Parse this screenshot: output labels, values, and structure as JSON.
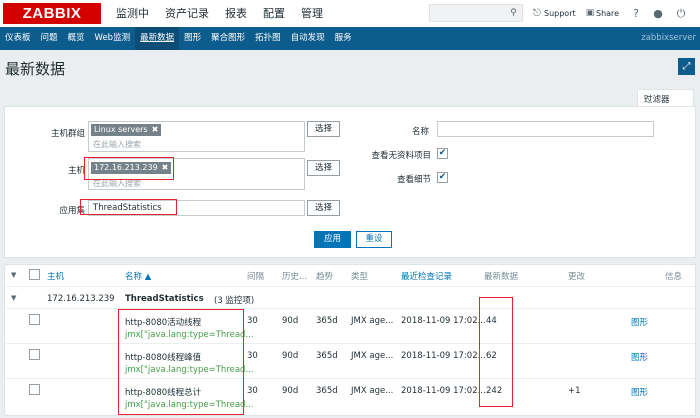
{
  "topbar": {
    "logo": "ZABBIX",
    "menu": [
      "监测中",
      "资产记录",
      "报表",
      "配置",
      "管理"
    ],
    "support": "Support",
    "share": "Share",
    "help": "?"
  },
  "submenu": {
    "items": [
      "仪表板",
      "问题",
      "概览",
      "Web监测",
      "最新数据",
      "图形",
      "聚合图形",
      "拓扑图",
      "自动发现",
      "服务"
    ],
    "server": "zabbixserver"
  },
  "page": {
    "title": "最新数据"
  },
  "filter": {
    "tab_label": "过滤器",
    "host_group_label": "主机群组",
    "host_group_tag": "Linux servers",
    "host_group_placeholder": "在此输入搜索",
    "host_label": "主机",
    "host_tag": "172.16.213.239",
    "host_placeholder": "在此输入搜索",
    "app_label": "应用集",
    "app_value": "ThreadStatistics",
    "select_label": "选择",
    "name_label": "名称",
    "name_value": "",
    "show_no_data_label": "查看无资料项目",
    "show_details_label": "查看细节",
    "check_mark": "✔",
    "apply": "应用",
    "reset": "重设"
  },
  "table": {
    "headers": {
      "host": "主机",
      "name": "名称 ▲",
      "interval": "间隔",
      "history": "历史...",
      "trends": "趋势",
      "type": "类型",
      "last_check": "最近检查记录",
      "last_value": "最新数据",
      "change": "更改",
      "info": "信息"
    },
    "group_host": "172.16.213.239",
    "group_app": "ThreadStatistics",
    "group_count": "(3 监控项)",
    "rows": [
      {
        "name": "http-8080活动线程",
        "key": "jmx[\"java.lang:type=Thread...",
        "interval": "30",
        "history": "90d",
        "trends": "365d",
        "type": "JMX age...",
        "last_check": "2018-11-09 17:02...",
        "last_value": "44",
        "change": "",
        "graph": "图形"
      },
      {
        "name": "http-8080线程峰值",
        "key": "jmx[\"java.lang:type=Thread...",
        "interval": "30",
        "history": "90d",
        "trends": "365d",
        "type": "JMX age...",
        "last_check": "2018-11-09 17:02...",
        "last_value": "62",
        "change": "",
        "graph": "图形"
      },
      {
        "name": "http-8080线程总计",
        "key": "jmx[\"java.lang:type=Thread...",
        "interval": "30",
        "history": "90d",
        "trends": "365d",
        "type": "JMX age...",
        "last_check": "2018-11-09 17:02...",
        "last_value": "242",
        "change": "+1",
        "graph": "图形"
      }
    ]
  }
}
